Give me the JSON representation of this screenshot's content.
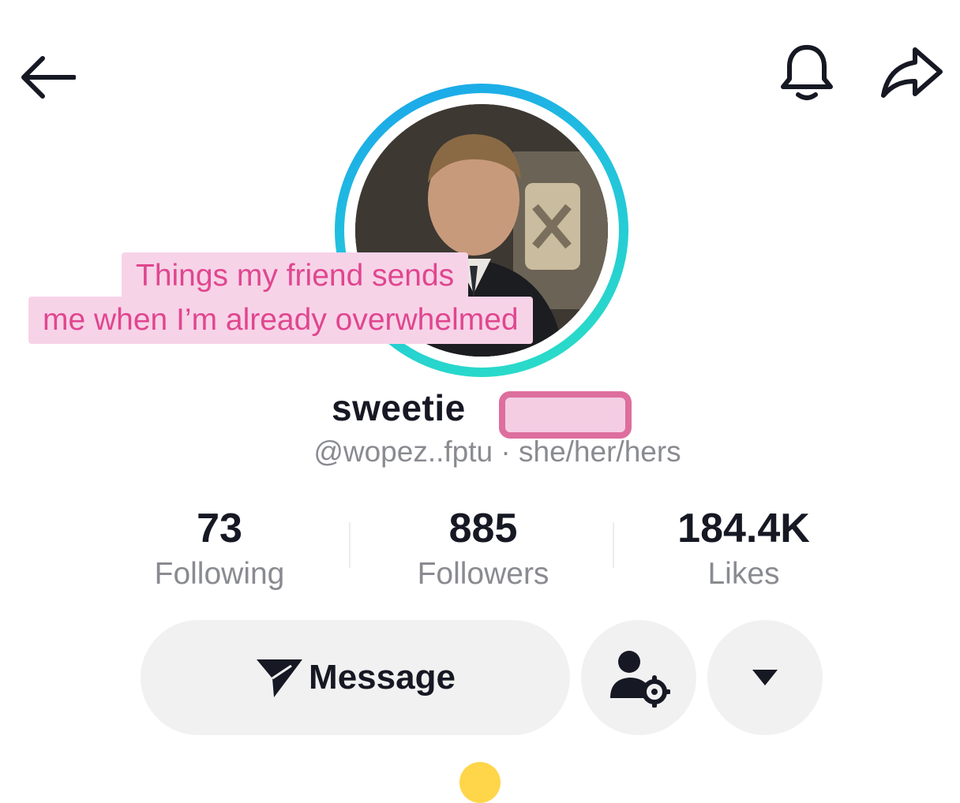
{
  "topbar": {
    "back_icon": "arrow-left-icon",
    "notify_icon": "bell-icon",
    "share_icon": "share-arrow-icon"
  },
  "profile": {
    "username": "sweetie",
    "handle": "@wopez..fptu",
    "pronouns": "she/her/hers",
    "handle_line": "@wopez..fptu · she/her/hers"
  },
  "overlay_caption": {
    "line1": "Things my friend sends",
    "line2": "me when I’m already overwhelmed"
  },
  "stats": [
    {
      "value": "73",
      "label": "Following"
    },
    {
      "value": "885",
      "label": "Followers"
    },
    {
      "value": "184.4K",
      "label": "Likes"
    }
  ],
  "actions": {
    "message_label": "Message",
    "message_icon": "send-plane-icon",
    "follow_settings_icon": "user-gear-icon",
    "more_icon": "caret-down-icon"
  },
  "colors": {
    "ring_gradient_start": "#1aa3ec",
    "ring_gradient_end": "#2be0c4",
    "caption_text": "#e0468f",
    "caption_bg": "#f7d3e8",
    "button_bg": "#f1f1f2"
  }
}
